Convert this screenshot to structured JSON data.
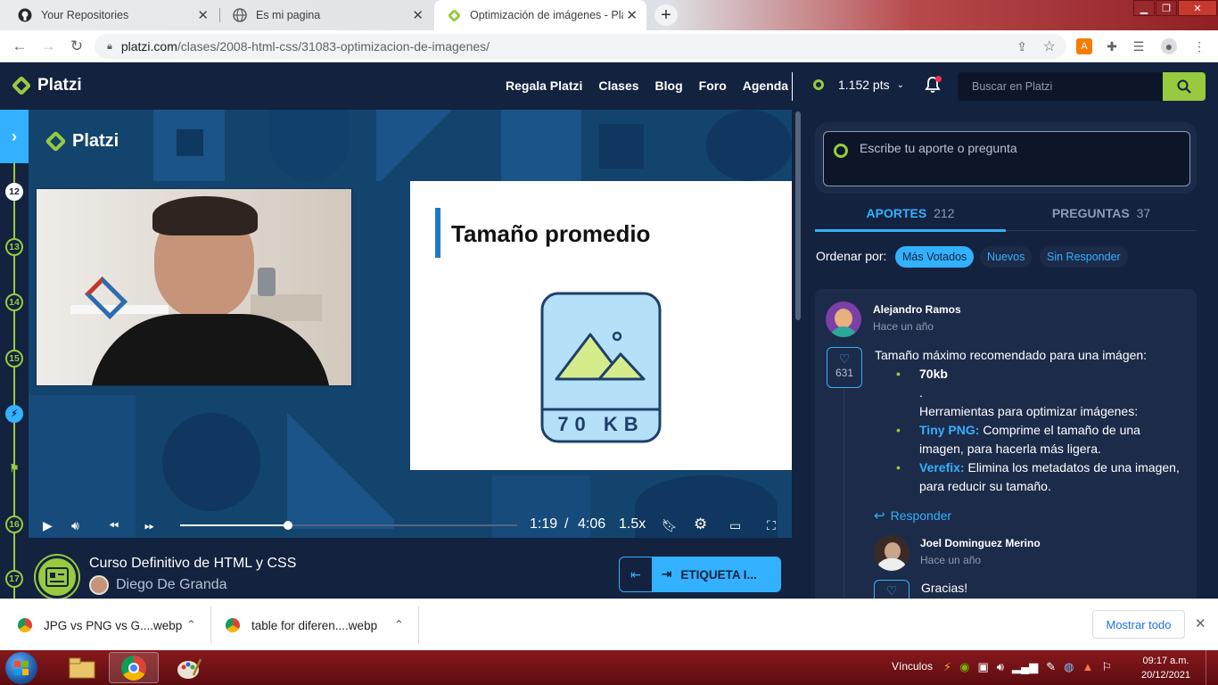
{
  "browser": {
    "tabs": [
      {
        "title": "Your Repositories",
        "icon": "github-icon"
      },
      {
        "title": "Es mi pagina",
        "icon": "globe-icon"
      },
      {
        "title": "Optimización de imágenes - Platzi",
        "icon": "platzi-icon",
        "active": true
      }
    ],
    "url_host": "platzi.com",
    "url_path": "/clases/2008-html-css/31083-optimizacion-de-imagenes/"
  },
  "header": {
    "logo": "Platzi",
    "nav": [
      "Regala Platzi",
      "Clases",
      "Blog",
      "Foro",
      "Agenda"
    ],
    "points": "1.152 pts",
    "search_placeholder": "Buscar en Platzi"
  },
  "rail": {
    "items": [
      "12",
      "13",
      "14",
      "15",
      "16",
      "17"
    ]
  },
  "video": {
    "logo": "Platzi",
    "slide_title": "Tamaño promedio",
    "slide_badge": "70 KB",
    "time_current": "1:19",
    "time_sep": "/",
    "time_total": "4:06",
    "speed": "1.5x",
    "progress": 0.32
  },
  "course": {
    "title": "Curso Definitivo de HTML y CSS",
    "teacher": "Diego De Granda",
    "next_label": "ETIQUETA I..."
  },
  "discussion": {
    "input_placeholder": "Escribe tu aporte o pregunta",
    "tab_aportes": "APORTES",
    "tab_aportes_count": "212",
    "tab_preguntas": "PREGUNTAS",
    "tab_preguntas_count": "37",
    "sort_label": "Ordenar por:",
    "sort_options": [
      "Más Votados",
      "Nuevos",
      "Sin Responder"
    ],
    "post": {
      "author": "Alejandro Ramos",
      "time": "Hace un año",
      "likes": "631",
      "intro": "Tamaño máximo recomendado para una imágen:",
      "bullet1": "70kb",
      "dot": ".",
      "tools_heading": "Herramientas para optimizar imágenes:",
      "tiny_label": "Tiny PNG:",
      "tiny_text": "Comprime el tamaño de una imagen, para hacerla más ligera.",
      "verefix_label": "Verefix:",
      "verefix_text": "Elimina los metadatos de una imagen, para reducir su tamaño.",
      "reply": "Responder"
    },
    "reply": {
      "author": "Joel Dominguez Merino",
      "time": "Hace un año",
      "text": "Gracias!"
    }
  },
  "downloads": {
    "items": [
      "JPG vs PNG vs G....webp",
      "table for diferen....webp"
    ],
    "show_all": "Mostrar todo"
  },
  "taskbar": {
    "links_label": "Vínculos",
    "time": "09:17 a.m.",
    "date": "20/12/2021"
  },
  "colors": {
    "platzi_green": "#98ca3f",
    "platzi_blue": "#33b1ff",
    "bg_dark": "#13223f"
  }
}
